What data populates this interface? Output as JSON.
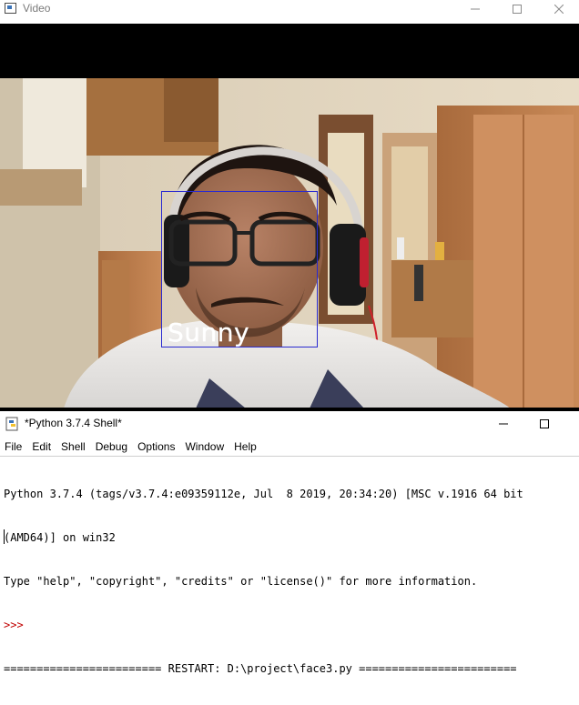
{
  "video_window": {
    "title": "Video",
    "title_icon": "window-app-icon",
    "controls": [
      "minimize-icon",
      "maximize-icon",
      "close-icon"
    ],
    "detection": {
      "label": "Sunny",
      "box_color": "#2a2ad0",
      "label_color": "#ffffff"
    }
  },
  "shell_window": {
    "title": "*Python 3.7.4 Shell*",
    "title_icon": "python-icon",
    "controls": [
      "minimize-icon",
      "maximize-icon"
    ],
    "menu": [
      "File",
      "Edit",
      "Shell",
      "Debug",
      "Options",
      "Window",
      "Help"
    ],
    "lines": [
      "Python 3.7.4 (tags/v3.7.4:e09359112e, Jul  8 2019, 20:34:20) [MSC v.1916 64 bit",
      "(AMD64)] on win32",
      "Type \"help\", \"copyright\", \"credits\" or \"license()\" for more information."
    ],
    "prompt": ">>>",
    "restart_line": "======================== RESTART: D:\\project\\face3.py ========================",
    "prompt_color": "#c00000"
  }
}
